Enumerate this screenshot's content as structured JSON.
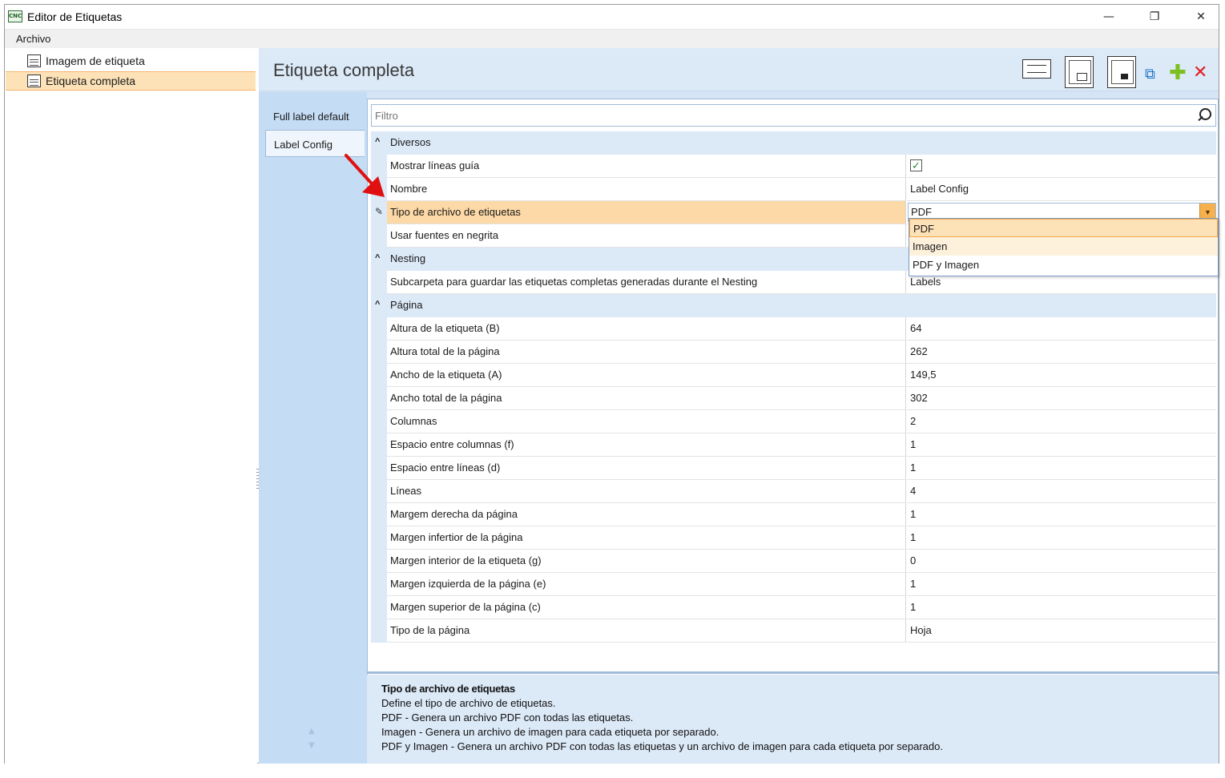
{
  "window": {
    "title": "Editor de Etiquetas",
    "app_icon_text": "CNC",
    "minimize": "—",
    "maximize": "❐",
    "close": "✕"
  },
  "menu": {
    "items": [
      "Archivo"
    ]
  },
  "tree": {
    "items": [
      {
        "label": "Imagem de etiqueta",
        "selected": false
      },
      {
        "label": "Etiqueta completa",
        "selected": true
      }
    ]
  },
  "header": {
    "title": "Etiqueta completa",
    "toolbar_icons": [
      "label-layout-icon",
      "full-label-icon",
      "image-label-icon",
      "copy-icon",
      "add-icon",
      "delete-icon"
    ]
  },
  "tabs": [
    {
      "label": "Full label default",
      "active": false
    },
    {
      "label": "Label Config",
      "active": true
    }
  ],
  "filter": {
    "placeholder": "Filtro"
  },
  "categories": [
    {
      "name": "Diversos",
      "props": [
        {
          "name": "Mostrar líneas guía",
          "value": "",
          "checked": true
        },
        {
          "name": "Nombre",
          "value": "Label Config"
        },
        {
          "name": "Tipo de archivo de etiquetas",
          "value": "PDF",
          "active": true
        },
        {
          "name": "Usar fuentes en negrita",
          "value": ""
        }
      ]
    },
    {
      "name": "Nesting",
      "props": [
        {
          "name": "Subcarpeta para guardar las etiquetas completas generadas durante el Nesting",
          "value": "Labels"
        }
      ]
    },
    {
      "name": "Página",
      "props": [
        {
          "name": "Altura de la etiqueta (B)",
          "value": "64"
        },
        {
          "name": "Altura total de la página",
          "value": "262"
        },
        {
          "name": "Ancho de la etiqueta (A)",
          "value": "149,5"
        },
        {
          "name": "Ancho total de la página",
          "value": "302"
        },
        {
          "name": "Columnas",
          "value": "2"
        },
        {
          "name": "Espacio entre columnas (f)",
          "value": "1"
        },
        {
          "name": "Espacio entre líneas (d)",
          "value": "1"
        },
        {
          "name": "Líneas",
          "value": "4"
        },
        {
          "name": "Margem derecha da página",
          "value": "1"
        },
        {
          "name": "Margen infertior de la página",
          "value": "1"
        },
        {
          "name": "Margen interior de la etiqueta (g)",
          "value": "0"
        },
        {
          "name": "Margen izquierda de la página (e)",
          "value": "1"
        },
        {
          "name": "Margen superior de la página (c)",
          "value": "1"
        },
        {
          "name": "Tipo de la página",
          "value": "Hoja"
        }
      ]
    }
  ],
  "dropdown": {
    "options": [
      "PDF",
      "Imagen",
      "PDF y Imagen"
    ],
    "selected": "PDF",
    "hovered": "Imagen"
  },
  "description": {
    "title": "Tipo de archivo de etiquetas",
    "lines": [
      "Define el tipo de archivo de etiquetas.",
      "PDF - Genera un archivo PDF con todas las etiquetas.",
      "Imagen - Genera un archivo de imagen para cada etiqueta por separado.",
      "PDF y Imagen - Genera un archivo PDF con todas las etiquetas y un archivo de imagen para cada etiqueta por separado."
    ]
  },
  "colors": {
    "accent_orange": "#f6b14e",
    "selection": "#fde2b8",
    "panel_blue": "#dce9f7",
    "annotation_arrow": "#e01010"
  }
}
